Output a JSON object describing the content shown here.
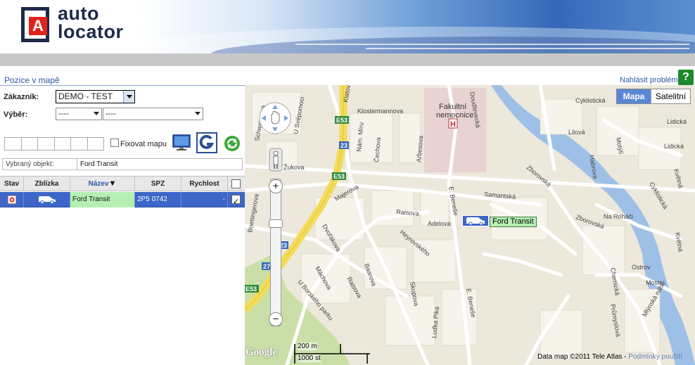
{
  "brand": {
    "logo_letter": "A",
    "line1": "auto",
    "line2": "locator"
  },
  "page": {
    "title": "Pozice v mapě",
    "report_link": "Nahlásit problém",
    "help_label": "?"
  },
  "filters": {
    "customer_label": "Zákazník:",
    "customer_value": "DEMO - TEST",
    "selection_label": "Výběr:",
    "selection_value1": "----",
    "selection_value2": "----",
    "fix_map_label": "Fixovat mapu",
    "fix_map_checked": false
  },
  "selected_object": {
    "label": "Vybraný objekt:",
    "value": "Ford Transit"
  },
  "table": {
    "columns": [
      "Stav",
      "Zblízka",
      "Název",
      "SPZ",
      "Rychlost"
    ],
    "sorted_column": "Název",
    "rows": [
      {
        "status": "stopped",
        "name": "Ford Transit",
        "spz": "2P5 0742",
        "speed": "-",
        "checked": true
      }
    ]
  },
  "map": {
    "type_buttons": [
      "Mapa",
      "Satelitní"
    ],
    "active_type": "Mapa",
    "marker_label": "Ford Transit",
    "scale_metric": "200 m",
    "scale_imperial": "1000 st",
    "google_logo": "Google",
    "attribution": "Data map ©2011 Tele Atlas -",
    "terms_link": "Podmínky použití",
    "street_labels": [
      "Cyklistická",
      "Lidická",
      "Lilová",
      "Habrova",
      "Motýlí",
      "Květná",
      "Zborovská",
      "Samantská",
      "Na Roháči",
      "Cyklistická",
      "Chemická",
      "Ostrov",
      "Mostní",
      "Mlýnská nábř.",
      "Průmyslová",
      "Květná",
      "Doudlevecká",
      "Klatovská tř.",
      "Klostermannova",
      "Čechova",
      "Arbesova",
      "E. Beneše",
      "Raisova",
      "Majerova",
      "Adelova",
      "Heyrovského",
      "Dvořákova",
      "Máchova",
      "Baarova",
      "Skupova",
      "Raisova",
      "U Borského parku",
      "E. Beneše",
      "Boettingerova",
      "Žukova",
      "U Svépomoci",
      "Schwaigrova",
      "Luďka Pika",
      "Nám. Míru"
    ],
    "poi_labels": [
      "Fakultní",
      "nemocnice",
      "H"
    ],
    "road_shields": [
      "E53",
      "23",
      "E53",
      "23",
      "27",
      "E53"
    ]
  }
}
